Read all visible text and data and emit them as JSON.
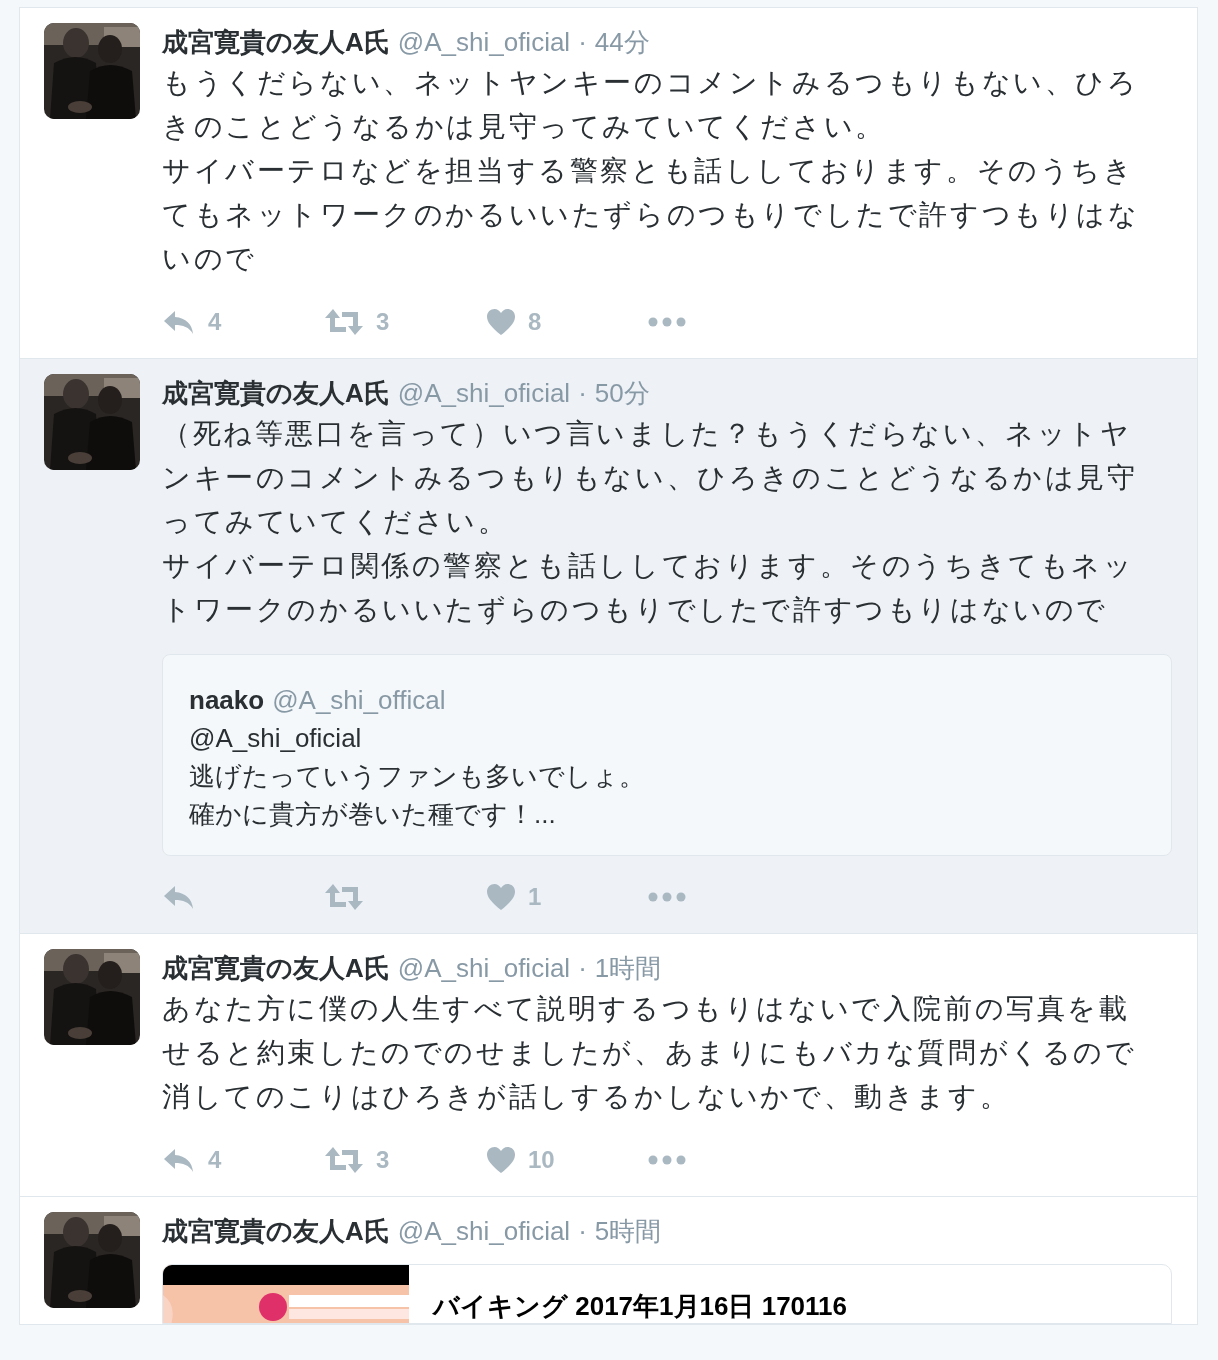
{
  "tweets": [
    {
      "name": "成宮寛貴の友人A氏",
      "handle": "@A_shi_oficial",
      "separator": "·",
      "time": "44分",
      "highlighted": false,
      "body": [
        "もうくだらない、ネットヤンキーのコメントみるつもりもない、ひろきのことどうなるかは見守ってみていてください。",
        "サイバーテロなどを担当する警察とも話ししております。そのうちきてもネットワークのかるいいたずらのつもりでしたで許すつもりはないので"
      ],
      "actions": [
        {
          "kind": "reply",
          "count": "4"
        },
        {
          "kind": "retweet",
          "count": "3"
        },
        {
          "kind": "like",
          "count": "8"
        },
        {
          "kind": "more"
        }
      ]
    },
    {
      "name": "成宮寛貴の友人A氏",
      "handle": "@A_shi_oficial",
      "separator": "·",
      "time": "50分",
      "highlighted": true,
      "body": [
        "（死ね等悪口を言って）いつ言いました？もうくだらない、ネットヤンキーのコメントみるつもりもない、ひろきのことどうなるかは見守ってみていてください。",
        "サイバーテロ関係の警察とも話ししております。そのうちきてもネットワークのかるいいたずらのつもりでしたで許すつもりはないので"
      ],
      "quote": {
        "name": "naako",
        "handle": "@A_shi_offical",
        "lines": [
          "@A_shi_oficial",
          "逃げたっていうファンも多いでしょ。",
          "確かに貴方が巻いた種です！..."
        ]
      },
      "actions": [
        {
          "kind": "reply"
        },
        {
          "kind": "retweet"
        },
        {
          "kind": "like",
          "count": "1"
        },
        {
          "kind": "more"
        }
      ]
    },
    {
      "name": "成宮寛貴の友人A氏",
      "handle": "@A_shi_oficial",
      "separator": "·",
      "time": "1時間",
      "highlighted": false,
      "body": [
        "あなた方に僕の人生すべて説明するつもりはないで入院前の写真を載せると約束したのでのせましたが、あまりにもバカな質問がくるので消してのこりはひろきが話しするかしないかで、動きます。"
      ],
      "actions": [
        {
          "kind": "reply",
          "count": "4"
        },
        {
          "kind": "retweet",
          "count": "3"
        },
        {
          "kind": "like",
          "count": "10"
        },
        {
          "kind": "more"
        }
      ]
    },
    {
      "name": "成宮寛貴の友人A氏",
      "handle": "@A_shi_oficial",
      "separator": "·",
      "time": "5時間",
      "highlighted": false,
      "card": {
        "kind": "picture",
        "title": "バイキング 2017年1月16日 170116"
      }
    }
  ]
}
